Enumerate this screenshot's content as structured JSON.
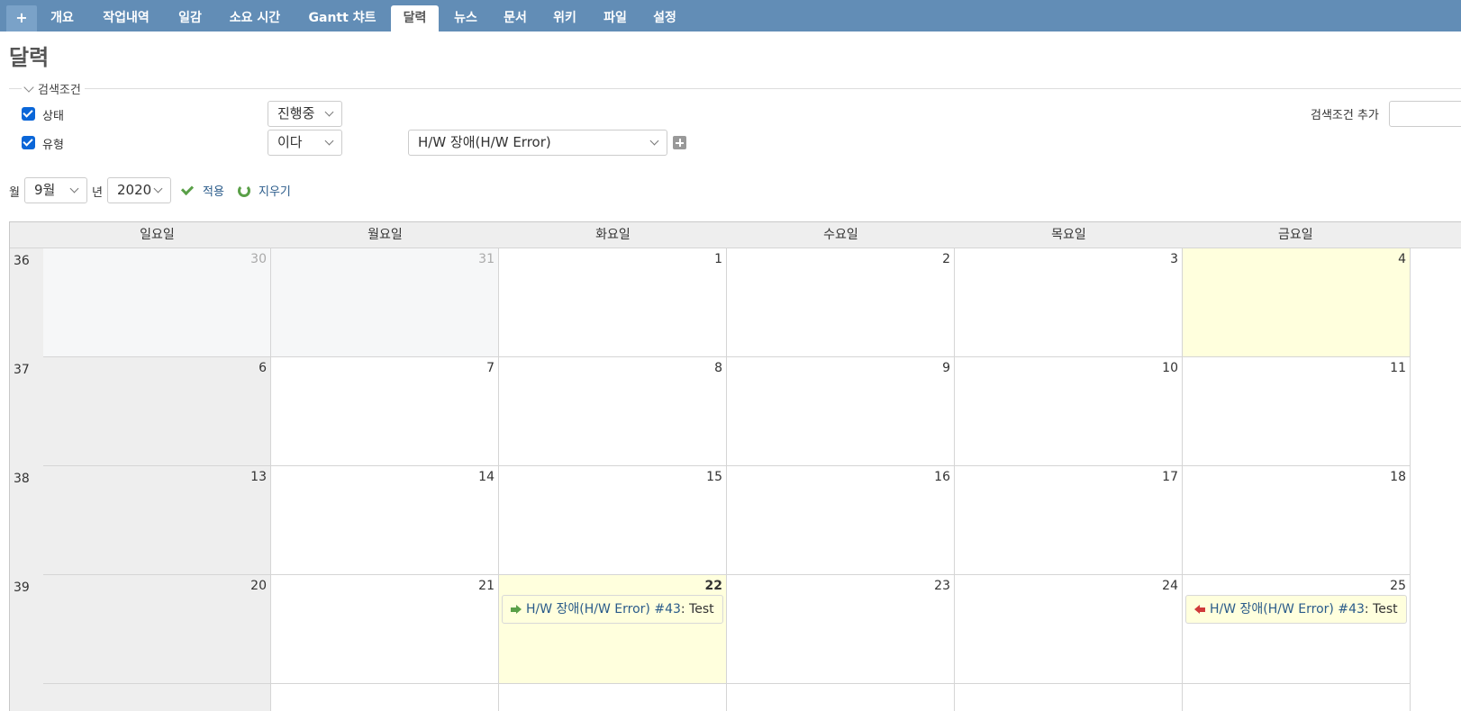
{
  "nav": {
    "plus": "+",
    "tabs": [
      "개요",
      "작업내역",
      "일감",
      "소요 시간",
      "Gantt 챠트",
      "달력",
      "뉴스",
      "문서",
      "위키",
      "파일",
      "설정"
    ],
    "active": "달력"
  },
  "page": {
    "title": "달력"
  },
  "filters": {
    "legend": "검색조건",
    "status": {
      "label": "상태",
      "operator": "진행중"
    },
    "tracker": {
      "label": "유형",
      "operator": "이다",
      "value": "H/W 장애(H/W Error)"
    },
    "add_label": "검색조건 추가"
  },
  "period": {
    "month_label": "월",
    "month": "9월",
    "year_label": "년",
    "year": "2020",
    "apply": "적용",
    "clear": "지우기"
  },
  "calendar": {
    "weekdays": [
      "일요일",
      "월요일",
      "화요일",
      "수요일",
      "목요일",
      "금요일"
    ],
    "weeks": [
      {
        "num": "36",
        "days": [
          "30",
          "31",
          "1",
          "2",
          "3",
          "4"
        ]
      },
      {
        "num": "37",
        "days": [
          "6",
          "7",
          "8",
          "9",
          "10",
          "11"
        ]
      },
      {
        "num": "38",
        "days": [
          "13",
          "14",
          "15",
          "16",
          "17",
          "18"
        ]
      },
      {
        "num": "39",
        "days": [
          "20",
          "21",
          "22",
          "23",
          "24",
          "25"
        ]
      }
    ],
    "issues": {
      "start": {
        "link": "H/W 장애(H/W Error) #43",
        "subject": ": Test"
      },
      "end": {
        "link": "H/W 장애(H/W Error) #43",
        "subject": ": Test"
      }
    }
  },
  "colors": {
    "nav_bg": "#628db6",
    "today_bg": "#ffffdd",
    "link": "#2a5b8a"
  }
}
